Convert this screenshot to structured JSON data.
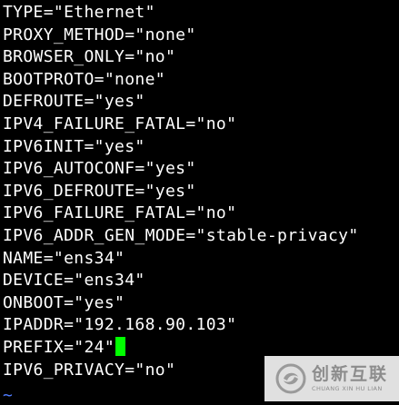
{
  "terminal": {
    "lines": [
      "TYPE=\"Ethernet\"",
      "PROXY_METHOD=\"none\"",
      "BROWSER_ONLY=\"no\"",
      "BOOTPROTO=\"none\"",
      "DEFROUTE=\"yes\"",
      "IPV4_FAILURE_FATAL=\"no\"",
      "IPV6INIT=\"yes\"",
      "IPV6_AUTOCONF=\"yes\"",
      "IPV6_DEFROUTE=\"yes\"",
      "IPV6_FAILURE_FATAL=\"no\"",
      "IPV6_ADDR_GEN_MODE=\"stable-privacy\"",
      "NAME=\"ens34\"",
      "DEVICE=\"ens34\"",
      "ONBOOT=\"yes\"",
      "IPADDR=\"192.168.90.103\"",
      "PREFIX=\"24\"",
      "IPV6_PRIVACY=\"no\""
    ],
    "empty_line_marker": "~",
    "cursor_line": 15,
    "colors": {
      "background": "#000000",
      "text": "#ffffff",
      "cursor": "#00ff00",
      "tilde": "#4f7cff"
    }
  },
  "watermark": {
    "text_cn": "创新互联",
    "text_en": "CHUANG XIN HU LIAN",
    "logo_icon": "swirl-logo-icon"
  }
}
